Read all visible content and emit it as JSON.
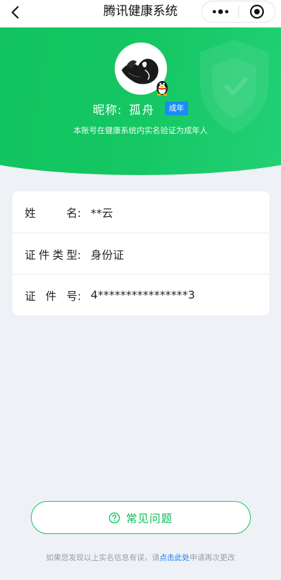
{
  "nav": {
    "title": "腾讯健康系统",
    "back_icon": "chevron-left-icon",
    "more_icon": "more-dots-icon",
    "close_icon": "target-close-icon"
  },
  "profile": {
    "nickname_label": "昵称:",
    "nickname": "孤舟",
    "badge": "成年",
    "verify_note": "本账号在健康系统内实名验证为成年人"
  },
  "info": {
    "rows": [
      {
        "label": [
          "姓",
          "名:"
        ],
        "value": "**云"
      },
      {
        "label": [
          "证",
          "件",
          "类",
          "型:"
        ],
        "value": "身份证"
      },
      {
        "label": [
          "证",
          "件",
          "号:"
        ],
        "value": "4****************3"
      }
    ]
  },
  "faq": {
    "label": "常见问题",
    "icon": "question-circle-icon"
  },
  "footer": {
    "prefix": "如果您发现以上实名信息有误，请",
    "link": "点击此处",
    "suffix": "申请再次更改"
  },
  "colors": {
    "brand_green": "#0fc35d",
    "badge_blue": "#1b8cf4",
    "link_blue": "#1b7cf4",
    "page_bg": "#eef1f5"
  }
}
